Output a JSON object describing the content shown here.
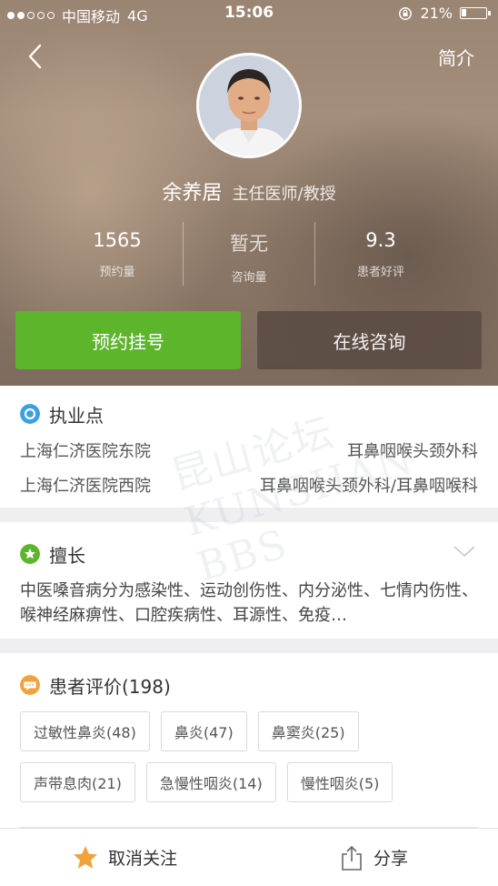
{
  "status_bar": {
    "carrier": "中国移动",
    "network": "4G",
    "time": "15:06",
    "battery_percent": "21%",
    "battery_level": 0.21,
    "signal_bars": 2
  },
  "nav": {
    "back_icon": "chevron-left-icon",
    "intro_label": "简介"
  },
  "doctor": {
    "name": "余养居",
    "title": "主任医师/教授"
  },
  "stats": [
    {
      "value": "1565",
      "label": "预约量"
    },
    {
      "value": "暂无",
      "label": "咨询量"
    },
    {
      "value": "9.3",
      "label": "患者好评"
    }
  ],
  "actions": {
    "book_label": "预约挂号",
    "consult_label": "在线咨询"
  },
  "practice": {
    "title": "执业点",
    "locations": [
      {
        "hospital": "上海仁济医院东院",
        "department": "耳鼻咽喉头颈外科"
      },
      {
        "hospital": "上海仁济医院西院",
        "department": "耳鼻咽喉头颈外科/耳鼻咽喉科"
      }
    ]
  },
  "specialty": {
    "title": "擅长",
    "text": "中医嗓音病分为感染性、运动创伤性、内分泌性、七情内伤性、喉神经麻痹性、口腔疾病性、耳源性、免疫…"
  },
  "reviews": {
    "title": "患者评价(198)",
    "tags": [
      [
        "过敏性鼻炎(48)",
        "鼻炎(47)",
        "鼻窦炎(25)"
      ],
      [
        "声带息肉(21)",
        "急慢性咽炎(14)",
        "慢性咽炎(5)"
      ]
    ]
  },
  "bottom_bar": {
    "unfollow_label": "取消关注",
    "share_label": "分享"
  },
  "watermark": "昆山论坛 KUNSHAN BBS",
  "colors": {
    "green": "#5db52b",
    "consult_brown": "#5c4d45",
    "practice_icon": "#3aa0e0",
    "specialty_icon": "#5db52b",
    "review_icon": "#f2a23a",
    "star": "#f2a23a"
  }
}
